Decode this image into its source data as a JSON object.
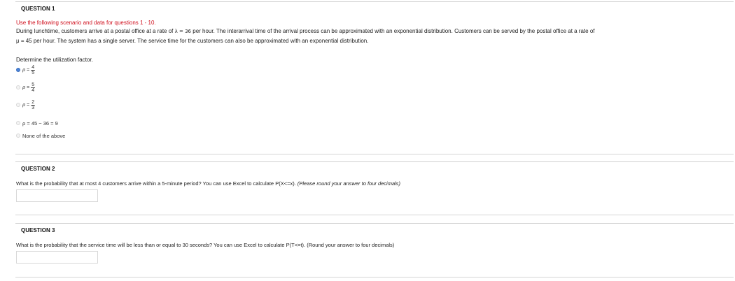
{
  "questions": [
    {
      "title": "QUESTION 1",
      "intro": "Use the following scenario and data for questions 1 - 10.",
      "scenario_line1_a": "During lunchtime, customers arrive at a postal office at a rate of",
      "scenario_lambda": "λ = 36",
      "scenario_line1_b": "per hour. The interarrival time of the arrival process can be approximated with an exponential distribution. Customers can be served by the postal office at a rate of",
      "scenario_line2": "μ = 45 per hour. The system has a single server. The service time for the customers can also be approximated with an exponential distribution.",
      "prompt": "Determine the utilization factor.",
      "options": [
        {
          "rho": "ρ",
          "eq": "=",
          "num": "4",
          "den": "5",
          "selected": true
        },
        {
          "rho": "ρ",
          "eq": "=",
          "num": "5",
          "den": "4",
          "selected": false
        },
        {
          "rho": "ρ",
          "eq": "=",
          "num": "2",
          "den": "3",
          "selected": false
        },
        {
          "text": "ρ = 45 − 36 = 9",
          "selected": false
        },
        {
          "text": "None of the above",
          "selected": false
        }
      ]
    },
    {
      "title": "QUESTION 2",
      "prompt": "What is the probability that at most 4 customers arrive within a 5-minute period? You can use Excel to calculate P(X<=x).",
      "prompt_italic": "(Please round your answer to four decimals)",
      "answer_value": ""
    },
    {
      "title": "QUESTION 3",
      "prompt": "What is the probability that the service time will be less than or equal to 30 seconds? You can use Excel to calculate P(T<=t). (Round your answer to four decimals)",
      "answer_value": ""
    }
  ]
}
